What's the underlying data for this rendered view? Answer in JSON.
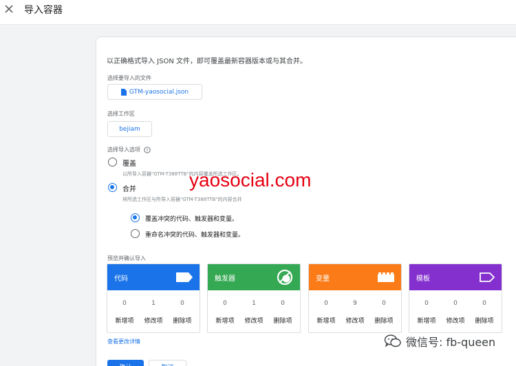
{
  "header": {
    "title": "导入容器",
    "close_icon": "close-icon"
  },
  "card": {
    "description": "以正确格式导入 JSON 文件，即可覆盖最新容器版本或与其合并。",
    "file_section": {
      "label": "选择要导入的文件",
      "file_name": "GTM-yaosocial.json",
      "icon": "file-icon"
    },
    "workspace_section": {
      "label": "选择工作区",
      "workspace_name": "bejiam"
    },
    "import_options": {
      "label": "选择导入选项",
      "help_icon": "help-icon",
      "options": [
        {
          "title": "覆盖",
          "subtitle": "以所导入容器\"GTM-T388TTB\"的内容覆盖所选工作区。",
          "selected": false
        },
        {
          "title": "合并",
          "subtitle": "将所选工作区与所导入容器\"GTM-T388TTB\"的内容合并",
          "selected": true
        }
      ],
      "merge_options": [
        {
          "label": "覆盖冲突的代码、触发器和变量。",
          "selected": true
        },
        {
          "label": "重命名冲突的代码、触发器和变量。",
          "selected": false
        }
      ]
    },
    "preview": {
      "label": "预览并确认导入",
      "tiles": [
        {
          "title": "代码",
          "color": "#1a73e8",
          "icon": "tag-icon",
          "new": "0",
          "modified": "1",
          "deleted": "0"
        },
        {
          "title": "触发器",
          "color": "#34a853",
          "icon": "trigger-icon",
          "new": "0",
          "modified": "1",
          "deleted": "0"
        },
        {
          "title": "变量",
          "color": "#fa7b17",
          "icon": "variable-blocks-icon",
          "new": "0",
          "modified": "9",
          "deleted": "0"
        },
        {
          "title": "模板",
          "color": "#8430ce",
          "icon": "template-icon",
          "new": "0",
          "modified": "0",
          "deleted": "0"
        }
      ],
      "stat_labels": {
        "new": "新增项",
        "modified": "修改项",
        "deleted": "删除项"
      }
    },
    "details_link": "查看更改详情",
    "buttons": {
      "confirm": "确认",
      "cancel": "取消"
    }
  },
  "overlay": {
    "watermark": "yaosocial.com",
    "watermark_color": "#e50012",
    "wechat_label": "微信号: fb-queen",
    "wechat_icon": "wechat-icon"
  }
}
